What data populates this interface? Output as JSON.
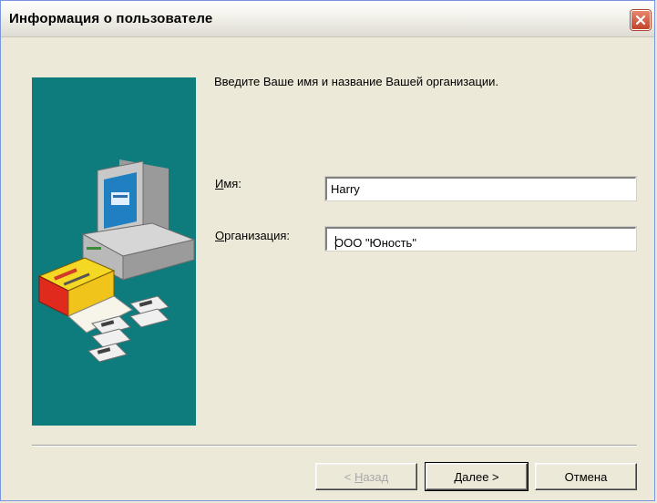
{
  "window": {
    "title": "Информация о пользователе"
  },
  "main": {
    "instruction": "Введите Ваше имя и название Вашей организации.",
    "name_label_access": "И",
    "name_label_rest": "мя:",
    "name_value": "Harry",
    "org_label_access": "О",
    "org_label_rest": "рганизация:",
    "org_value": "ООО \"Юность\""
  },
  "buttons": {
    "back_prefix": "< ",
    "back_access": "Н",
    "back_rest": "азад",
    "next_access": "Д",
    "next_rest": "алее >",
    "cancel": "Отмена"
  },
  "colors": {
    "panel": "#0e7b7c",
    "close_button": "#c2432b"
  },
  "icons": {
    "close": "close-icon",
    "illustration": "computer-with-software-box-and-disks"
  }
}
